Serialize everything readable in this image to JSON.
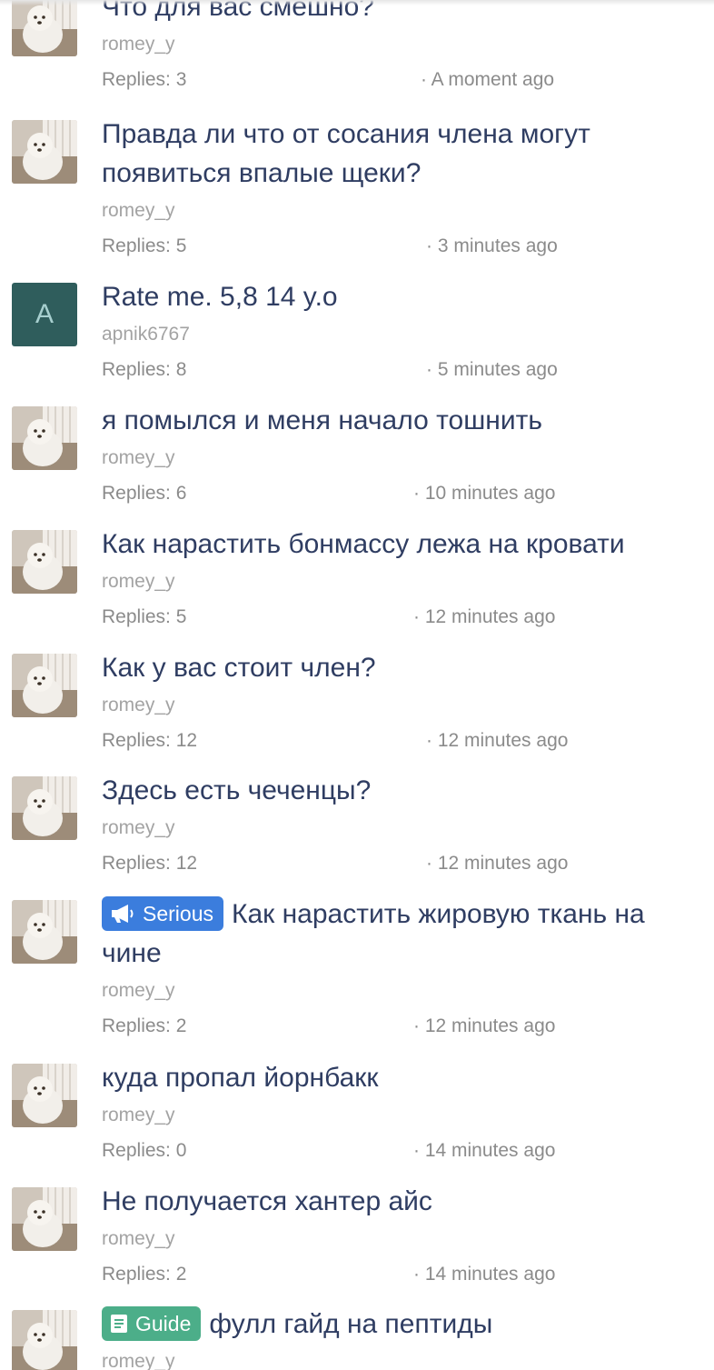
{
  "colors": {
    "title": "#2f3d62",
    "author": "#a3a3a3",
    "meta": "#8b8b8b",
    "serious_tag": "#3b7ddd",
    "guide_tag": "#4cae89",
    "letter_avatar_bg": "#2f5d5c"
  },
  "threads": [
    {
      "title": "Что для вас смешно?",
      "author": "romey_y",
      "replies": "Replies: 3",
      "time": "· A moment ago",
      "avatar": "dog-photo"
    },
    {
      "title": "Правда ли что от сосания члена могут появиться впалые щеки?",
      "author": "romey_y",
      "replies": "Replies: 5",
      "time": "· 3 minutes ago",
      "avatar": "dog-photo"
    },
    {
      "title": "Rate me. 5,8 14 y.o",
      "author": "apnik6767",
      "replies": "Replies: 8",
      "time": "· 5 minutes ago",
      "avatar": "letter",
      "avatar_letter": "A"
    },
    {
      "title": "я помылся и меня начало тошнить",
      "author": "romey_y",
      "replies": "Replies: 6",
      "time": "· 10 minutes ago",
      "avatar": "dog-photo"
    },
    {
      "title": "Как нарастить бонмассу лежа на кровати",
      "author": "romey_y",
      "replies": "Replies: 5",
      "time": "· 12 minutes ago",
      "avatar": "dog-photo"
    },
    {
      "title": "Как у вас стоит член?",
      "author": "romey_y",
      "replies": "Replies: 12",
      "time": "· 12 minutes ago",
      "avatar": "dog-photo"
    },
    {
      "title": "Здесь есть чеченцы?",
      "author": "romey_y",
      "replies": "Replies: 12",
      "time": "· 12 minutes ago",
      "avatar": "dog-photo"
    },
    {
      "title": "Как нарастить жировую ткань на чине",
      "author": "romey_y",
      "replies": "Replies: 2",
      "time": "· 12 minutes ago",
      "avatar": "dog-photo",
      "tag": {
        "label": "Serious",
        "icon": "megaphone-icon"
      }
    },
    {
      "title": "куда пропал йорнбакк",
      "author": "romey_y",
      "replies": "Replies: 0",
      "time": "· 14 minutes ago",
      "avatar": "dog-photo"
    },
    {
      "title": "Не получается хантер айс",
      "author": "romey_y",
      "replies": "Replies: 2",
      "time": "· 14 minutes ago",
      "avatar": "dog-photo"
    },
    {
      "title": "фулл гайд на пептиды",
      "author": "romey_y",
      "replies": "",
      "time": "",
      "avatar": "dog-photo",
      "tag": {
        "label": "Guide",
        "icon": "book-icon"
      }
    }
  ]
}
